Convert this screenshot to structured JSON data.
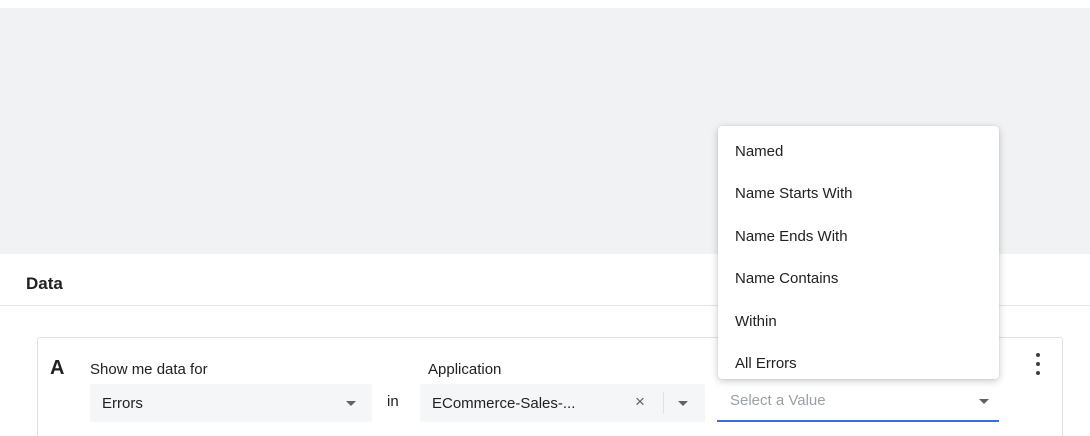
{
  "query": {
    "row_letter": "A",
    "show_label": "Show me data for",
    "show_value": "Errors",
    "in_text": "in",
    "application_label": "Application",
    "application_value": "ECommerce-Sales-...",
    "clear_glyph": "×",
    "value_placeholder": "Select a Value"
  },
  "data_section": {
    "title": "Data"
  },
  "dropdown": {
    "items": [
      "Named",
      "Name Starts With",
      "Name Ends With",
      "Name Contains",
      "Within",
      "All Errors"
    ]
  },
  "colors": {
    "preview_background": "#f1f2f4",
    "focus_underline": "#3a6fe0"
  },
  "icons": {
    "caret": "chevron-down-icon",
    "clear": "close-icon",
    "more": "more-vertical-icon"
  }
}
